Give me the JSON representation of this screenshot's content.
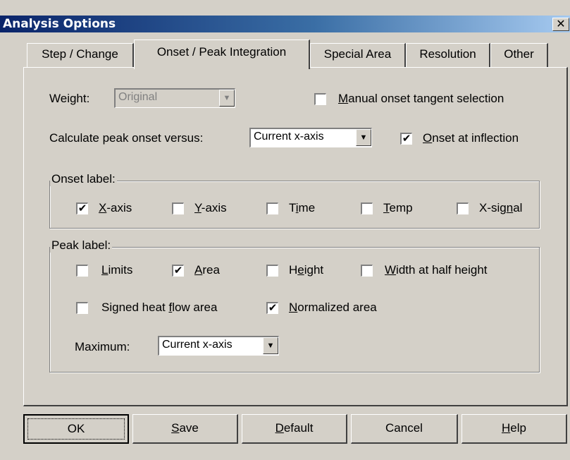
{
  "window": {
    "title": "Analysis Options",
    "close_glyph": "✕"
  },
  "tabs": [
    {
      "label": "Step / Change",
      "active": false
    },
    {
      "label": "Onset / Peak Integration",
      "active": true
    },
    {
      "label": "Special Area",
      "active": false
    },
    {
      "label": "Resolution",
      "active": false
    },
    {
      "label": "Other",
      "active": false
    }
  ],
  "options": {
    "weight_label": "Weight:",
    "weight_value": "Original",
    "manual_onset": {
      "pre": "",
      "key": "M",
      "post": "anual onset tangent selection",
      "checked": false
    },
    "calc_label": "Calculate peak onset versus:",
    "calc_value": "Current x-axis",
    "onset_inflection": {
      "pre": "",
      "key": "O",
      "post": "nset at inflection",
      "checked": true
    }
  },
  "onset_label": {
    "title": "Onset label:",
    "items": [
      {
        "pre": "",
        "key": "X",
        "post": "-axis",
        "checked": true
      },
      {
        "pre": "",
        "key": "Y",
        "post": "-axis",
        "checked": false
      },
      {
        "pre": "T",
        "key": "i",
        "post": "me",
        "checked": false
      },
      {
        "pre": "",
        "key": "T",
        "post": "emp",
        "checked": false
      },
      {
        "pre": "X-sig",
        "key": "n",
        "post": "al",
        "checked": false
      }
    ]
  },
  "peak_label": {
    "title": "Peak label:",
    "items": [
      {
        "pre": "",
        "key": "L",
        "post": "imits",
        "checked": false
      },
      {
        "pre": "",
        "key": "A",
        "post": "rea",
        "checked": true
      },
      {
        "pre": "H",
        "key": "e",
        "post": "ight",
        "checked": false
      },
      {
        "pre": "",
        "key": "W",
        "post": "idth at half height",
        "checked": false
      },
      {
        "pre": "Signed heat ",
        "key": "f",
        "post": "low area",
        "checked": false
      },
      {
        "pre": "",
        "key": "N",
        "post": "ormalized area",
        "checked": true
      }
    ],
    "maximum_label": "Maximum:",
    "maximum_value": "Current x-axis"
  },
  "buttons": [
    {
      "pre": "OK",
      "key": "",
      "post": ""
    },
    {
      "pre": "",
      "key": "S",
      "post": "ave"
    },
    {
      "pre": "",
      "key": "D",
      "post": "efault"
    },
    {
      "pre": "Cancel",
      "key": "",
      "post": ""
    },
    {
      "pre": "",
      "key": "H",
      "post": "elp"
    }
  ],
  "glyphs": {
    "check": "✔",
    "arrow": "▼"
  }
}
